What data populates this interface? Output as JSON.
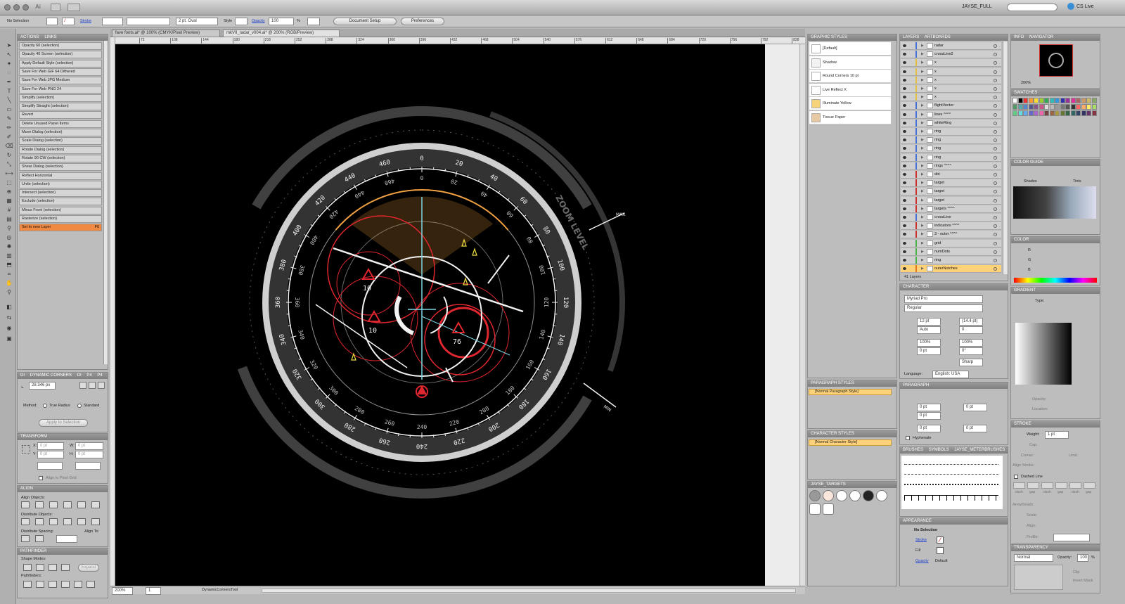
{
  "app": {
    "workspace": "JAYSE_FULL",
    "cs_live": "CS Live"
  },
  "control_bar": {
    "selection": "No Selection",
    "stroke_label": "Stroke",
    "brush": "2 pt. Oval",
    "style_label": "Style",
    "opacity_label": "Opacity",
    "opacity_value": "100",
    "opacity_unit": "%",
    "document_setup": "Document Setup",
    "preferences": "Preferences"
  },
  "tabs": [
    {
      "label": "fave fonts.ai* @ 100% (CMYK/Pixel Preview)"
    },
    {
      "label": "mkVII_radar_v004.ai* @ 200% (RGB/Preview)"
    }
  ],
  "panels": {
    "actions_tabs": [
      "ACTIONS",
      "LINKS"
    ],
    "actions": [
      "Opacity 60 (selection)",
      "Opacity 40 Screen (selection)",
      "Apply Default Style (selection)",
      "Save For Web GIF 64 Dithered",
      "Save For Web JPG Medium",
      "Save For Web PNG 24",
      "Simplify (selection)",
      "Simplify Straight (selection)",
      "Revert",
      "Delete Unused Panel Items",
      "Move Dialog (selection)",
      "Scale Dialog (selection)",
      "Rotate Dialog (selection)",
      "Rotate 90 CW (selection)",
      "Shear Dialog (selection)",
      "Reflect Horizontal",
      "Unite (selection)",
      "Intersect (selection)",
      "Exclude (selection)",
      "Minus Front (selection)",
      "Rasterize (selection)",
      "Set to new Layer"
    ],
    "last_action_key": "F6",
    "dynamic_corners": {
      "tabs": [
        "DI",
        "DYNAMIC CORNERS",
        "DI",
        "P4",
        "P4"
      ],
      "radius": "28.346 px",
      "method_label": "Method:",
      "true_radius": "True Radius",
      "standard": "Standard",
      "apply": "Apply to Selection"
    },
    "transform": {
      "title": "TRANSFORM",
      "x": "X:",
      "y": "Y:",
      "w": "W:",
      "h": "H:",
      "x_val": "0 pt",
      "y_val": "0 pt",
      "w_val": "0 pt",
      "h_val": "0 pt",
      "align_pixel": "Align to Pixel Grid"
    },
    "align": {
      "title": "ALIGN",
      "align_objects": "Align Objects:",
      "distribute_objects": "Distribute Objects:",
      "distribute_spacing": "Distribute Spacing:",
      "align_to": "Align To:"
    },
    "pathfinder": {
      "title": "PATHFINDER",
      "shape_modes": "Shape Modes:",
      "expand": "Expand",
      "pathfinders": "Pathfinders:"
    },
    "graphic_styles": {
      "title": "GRAPHIC STYLES",
      "items": [
        "[Default]",
        "Shadow",
        "Round Corners 10 pt",
        "Live Reflect X",
        "Illuminate Yellow",
        "Tissue Paper"
      ]
    },
    "paragraph_styles": {
      "title": "PARAGRAPH STYLES",
      "item": "[Normal Paragraph Style]"
    },
    "character_styles": {
      "title": "CHARACTER STYLES",
      "item": "[Normal Character Style]"
    },
    "jayse_targets": {
      "title": "JAYSE_TARGETS"
    },
    "layers": {
      "tabs": [
        "LAYERS",
        "ARTBOARDS"
      ],
      "items": [
        {
          "name": "radar",
          "color": "#4a6fd6"
        },
        {
          "name": "crossLine2",
          "color": "#4a6fd6"
        },
        {
          "name": "x",
          "color": "#e0c040"
        },
        {
          "name": "x",
          "color": "#e0c040"
        },
        {
          "name": "x",
          "color": "#e0c040"
        },
        {
          "name": "x",
          "color": "#e0c040"
        },
        {
          "name": "x",
          "color": "#e0c040"
        },
        {
          "name": "flightVector",
          "color": "#4a6fd6"
        },
        {
          "name": "lines ^^^^",
          "color": "#4a6fd6"
        },
        {
          "name": "whiteRing",
          "color": "#4a6fd6"
        },
        {
          "name": "ring",
          "color": "#4a6fd6"
        },
        {
          "name": "ring",
          "color": "#4a6fd6"
        },
        {
          "name": "ring",
          "color": "#4a6fd6"
        },
        {
          "name": "ring",
          "color": "#4a6fd6"
        },
        {
          "name": "rings ^^^^",
          "color": "#4a6fd6"
        },
        {
          "name": "dot",
          "color": "#c93030"
        },
        {
          "name": "target",
          "color": "#c93030"
        },
        {
          "name": "target",
          "color": "#c93030"
        },
        {
          "name": "target",
          "color": "#c93030"
        },
        {
          "name": "targets ^^^^",
          "color": "#c93030"
        },
        {
          "name": "crossLine",
          "color": "#4a6fd6"
        },
        {
          "name": "indicators ^^^^",
          "color": "#c93030"
        },
        {
          "name": "3 - outer ^^^^",
          "color": "#c93030"
        },
        {
          "name": "grid",
          "color": "#4ab04a"
        },
        {
          "name": "numDots",
          "color": "#4ab04a"
        },
        {
          "name": "ring",
          "color": "#4ab04a"
        },
        {
          "name": "outerNotches",
          "color": "#e07a20"
        }
      ],
      "count": "41 Layers"
    },
    "character": {
      "title": "CHARACTER",
      "font": "Myriad Pro",
      "style": "Regular",
      "size": "12 pt",
      "leading": "(14.4 pt)",
      "kerning": "Auto",
      "tracking": "0",
      "vscale": "100%",
      "hscale": "100%",
      "baseline": "0 pt",
      "rotation": "0°",
      "aa": "Sharp",
      "language_label": "Language:",
      "language": "English: USA"
    },
    "paragraph": {
      "title": "PARAGRAPH",
      "v1": "0 pt",
      "v2": "0 pt",
      "v3": "0 pt",
      "v4": "0 pt",
      "v5": "0 pt",
      "hyphenate": "Hyphenate"
    },
    "brushes": {
      "tabs": [
        "BRUSHES",
        "SYMBOLS",
        "JAYSE_METERBRUSHES"
      ]
    },
    "appearance": {
      "title": "APPEARANCE",
      "selection": "No Selection",
      "stroke": "Stroke",
      "fill": "Fill",
      "opacity": "Opacity",
      "opacity_val": "Default"
    },
    "info_nav": {
      "tabs": [
        "INFO",
        "NAVIGATOR"
      ],
      "zoom": "200%"
    },
    "swatches": {
      "title": "SWATCHES"
    },
    "color_guide": {
      "title": "COLOR GUIDE",
      "shades": "Shades",
      "tints": "Tints"
    },
    "color": {
      "title": "COLOR",
      "r": "R",
      "g": "G",
      "b": "B"
    },
    "gradient": {
      "title": "GRADIENT",
      "type": "Type:",
      "opacity": "Opacity:",
      "location": "Location:"
    },
    "stroke": {
      "title": "STROKE",
      "weight_label": "Weight:",
      "weight": "1 pt",
      "cap": "Cap:",
      "corner": "Corner:",
      "limit": "Limit:",
      "align_stroke": "Align Stroke:",
      "dashed": "Dashed Line",
      "dash_labels": [
        "dash",
        "gap",
        "dash",
        "gap",
        "dash",
        "gap"
      ],
      "arrowheads": "Arrowheads:",
      "scale": "Scale:",
      "align": "Align:",
      "profile": "Profile:"
    },
    "transparency": {
      "title": "TRANSPARENCY",
      "mode": "Normal",
      "opacity_label": "Opacity:",
      "opacity": "100",
      "unit": "%",
      "clip": "Clip",
      "invert": "Invert Mask"
    }
  },
  "status_bar": {
    "zoom": "200%",
    "page": "1",
    "tool": "DynamicCornersTool"
  },
  "ruler_marks": [
    "72",
    "108",
    "144",
    "180",
    "216",
    "252",
    "288",
    "324",
    "360",
    "396",
    "432",
    "468",
    "504",
    "540",
    "576",
    "612",
    "648",
    "684",
    "720",
    "756",
    "792",
    "828"
  ],
  "radar": {
    "headings": [
      "0",
      "20",
      "40",
      "60",
      "80",
      "100",
      "120",
      "140",
      "160",
      "180",
      "200",
      "220",
      "240",
      "260",
      "280",
      "300",
      "320",
      "340",
      "360",
      "380",
      "400",
      "420",
      "440",
      "460"
    ],
    "targets": [
      "10",
      "10",
      "76"
    ],
    "zoom_label": "ZOOM LEVEL",
    "min_label": "MIN",
    "max_label": "MAX",
    "colors": {
      "red": "#e0262e",
      "white": "#f2f2f2",
      "cyan": "#7fd8e6",
      "orange": "#f0a040",
      "grey": "#6a6a6a"
    }
  }
}
